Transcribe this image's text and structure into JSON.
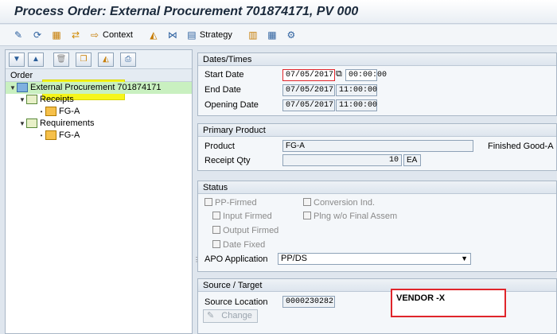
{
  "window": {
    "title": "Process Order: External Procurement 701874171, PV 000"
  },
  "toolbar": {
    "context_label": "Context",
    "strategy_label": "Strategy"
  },
  "tree": {
    "header": "Order",
    "root": "External Procurement 701874171",
    "receipts": "Receipts",
    "receipt_item": "FG-A",
    "requirements": "Requirements",
    "requirement_item": "FG-A"
  },
  "dates": {
    "section": "Dates/Times",
    "start_label": "Start Date",
    "start_date": "07/05/2017",
    "start_time": "00:00:00",
    "end_label": "End Date",
    "end_date": "07/05/2017",
    "end_time": "11:00:00",
    "opening_label": "Opening Date",
    "opening_date": "07/05/2017",
    "opening_time": "11:00:00"
  },
  "product": {
    "section": "Primary Product",
    "product_label": "Product",
    "product_value": "FG-A",
    "product_desc": "Finished Good-A",
    "qty_label": "Receipt Qty",
    "qty_value": "10",
    "qty_unit": "EA"
  },
  "status": {
    "section": "Status",
    "pp_firmed": "PP-Firmed",
    "conversion_ind": "Conversion Ind.",
    "input_firmed": "Input Firmed",
    "plng_final": "Plng w/o Final Assem",
    "output_firmed": "Output Firmed",
    "date_fixed": "Date Fixed",
    "apo_label": "APO Application",
    "apo_value": "PP/DS"
  },
  "source": {
    "section": "Source / Target",
    "location_label": "Source Location",
    "location_value": "0000230282",
    "change_label": "Change",
    "vendor": "VENDOR -X"
  },
  "colors": {
    "highlight": "#f6f61a",
    "annotation": "#e0252b",
    "tree_root": "#c9f0c0"
  }
}
